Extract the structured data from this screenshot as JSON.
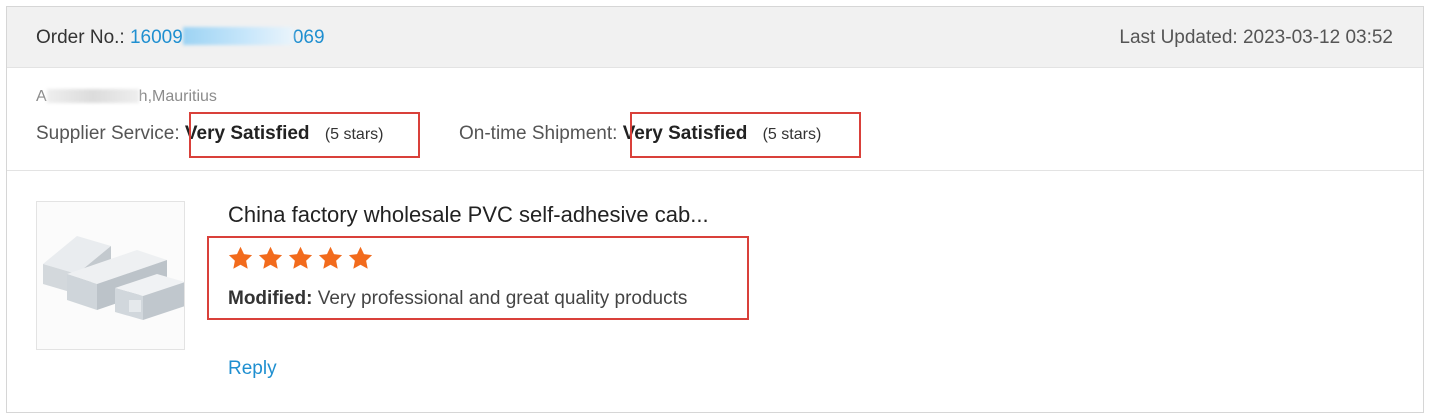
{
  "header": {
    "order_label": "Order No.:",
    "order_no_prefix": "16009",
    "order_no_suffix": "069",
    "last_updated": "Last Updated: 2023-03-12 03:52"
  },
  "meta": {
    "address_prefix": "A",
    "address_suffix": "h,Mauritius",
    "supplier_service": {
      "label": "Supplier Service:",
      "value": "Very Satisfied",
      "stars": "(5 stars)"
    },
    "ontime_shipment": {
      "label": "On-time Shipment:",
      "value": "Very Satisfied",
      "stars": "(5 stars)"
    }
  },
  "product": {
    "title": "China factory wholesale PVC self-adhesive cab...",
    "rating": 5,
    "star_color": "#f26b1d",
    "review_label": "Modified:",
    "review_text": " Very professional and great quality products"
  },
  "reply_label": "Reply",
  "colors": {
    "accent": "#1f8fd0",
    "highlight": "#d9403a"
  }
}
